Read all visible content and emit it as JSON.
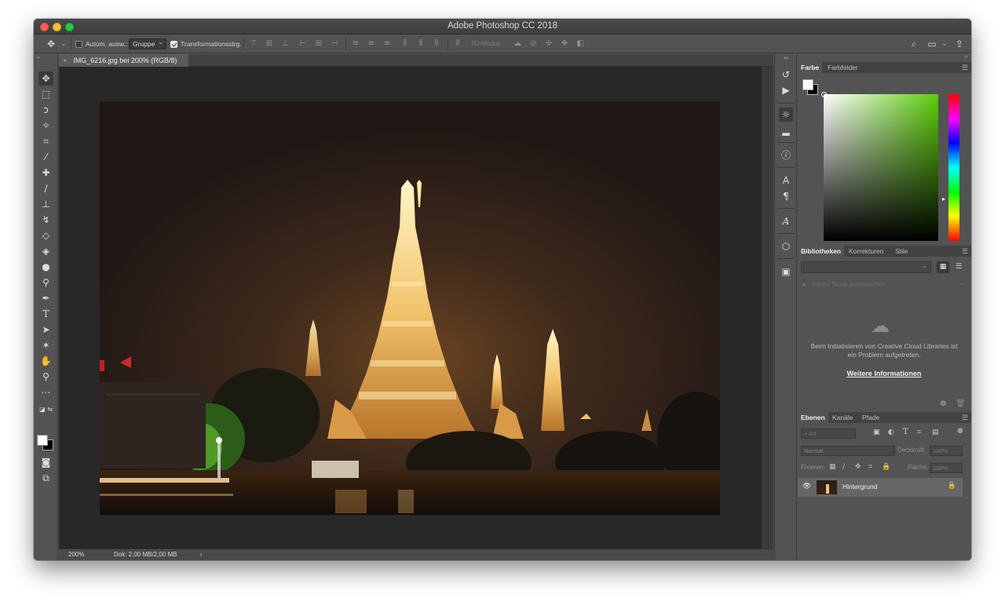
{
  "window": {
    "title": "Adobe Photoshop CC 2018"
  },
  "options_bar": {
    "auto_select_label": "Autom. ausw.:",
    "auto_select_value": "Gruppe",
    "transform_label": "Transformationsstrg.",
    "mode_3d_label": "3D-Modus:"
  },
  "document": {
    "tab_title": "IMG_6216.jpg bei 200% (RGB/8)",
    "close_glyph": "×"
  },
  "status_bar": {
    "zoom": "200%",
    "doc_size": "Dok: 2,00 MB/2,00 MB",
    "arrow": "›"
  },
  "color_panel": {
    "tabs": [
      "Farbe",
      "Farbfelder"
    ],
    "active_tab": "Farbe"
  },
  "libraries_panel": {
    "tabs": [
      "Bibliotheken",
      "Korrekturen",
      "Stile"
    ],
    "search_placeholder": "Adobe Stock durchsuchen",
    "error_message": "Beim Initialisieren von Creative Cloud Libraries ist ein Problem aufgetreten.",
    "more_info_link": "Weitere Informationen"
  },
  "layers_panel": {
    "tabs": [
      "Ebenen",
      "Kanäle",
      "Pfade"
    ],
    "filter_label": "Art",
    "blend_mode": "Normal",
    "opacity_label": "Deckkraft:",
    "opacity_value": "100%",
    "lock_label": "Fixieren:",
    "fill_label": "Fläche:",
    "fill_value": "100%",
    "layers": [
      {
        "name": "Hintergrund",
        "visible": true,
        "locked": true
      }
    ]
  },
  "colors": {
    "foreground": "#ffffff",
    "background": "#000000",
    "picker_hue": "#5ccd0a"
  }
}
